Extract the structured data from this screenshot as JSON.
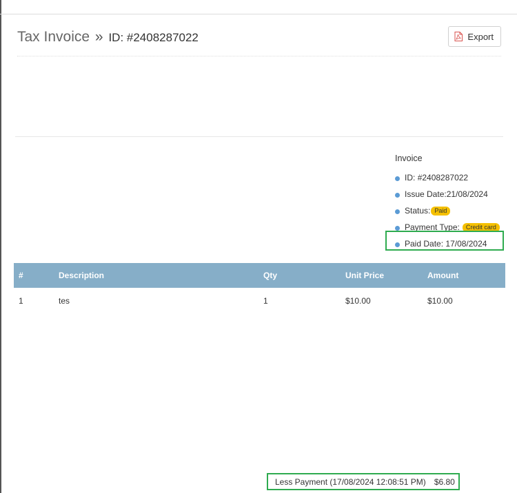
{
  "header": {
    "title": "Tax Invoice",
    "separator": "»",
    "invoice_id": "ID: #2408287022",
    "export_label": "Export"
  },
  "invoice_info": {
    "heading": "Invoice",
    "id_label": "ID:",
    "id_value": "#2408287022",
    "issue_date_label": "Issue Date:",
    "issue_date_value": "21/08/2024",
    "status_label": "Status:",
    "status_value": "Paid",
    "payment_type_label": "Payment Type:",
    "payment_type_value": "Credit card",
    "paid_date_label": "Paid Date:",
    "paid_date_value": "17/08/2024"
  },
  "table": {
    "headers": [
      "#",
      "Description",
      "Qty",
      "Unit Price",
      "Amount"
    ],
    "rows": [
      [
        "1",
        "tes",
        "1",
        "$10.00",
        "$10.00"
      ]
    ]
  },
  "less_payment": {
    "label": "Less Payment (17/08/2024 12:08:51 PM)",
    "amount": "$6.80"
  },
  "colors": {
    "table_header_bg": "#86aec8",
    "badge_bg": "#f5c000",
    "highlight_border": "#2eab4f",
    "bullet": "#5b9bd5"
  },
  "icons": {
    "export": "pdf-file-icon"
  }
}
